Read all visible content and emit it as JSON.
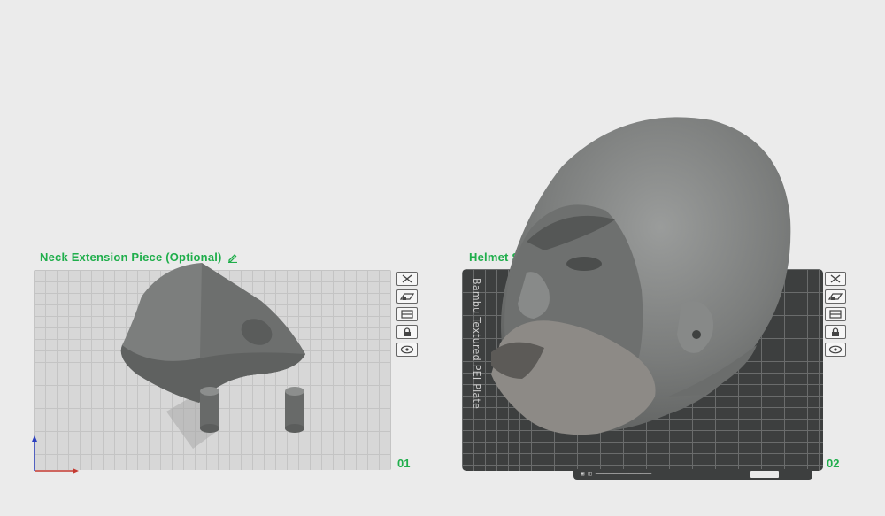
{
  "plates": [
    {
      "title": "Neck Extension Piece (Optional)",
      "number": "01",
      "toolbar": [
        "close-icon",
        "arrange-icon",
        "orient-icon",
        "lock-icon",
        "view-icon"
      ]
    },
    {
      "title": "Helmet S",
      "number": "02",
      "plate_label": "Bambu Textured PEI Plate",
      "toolbar": [
        "close-icon",
        "arrange-icon",
        "orient-icon",
        "lock-icon",
        "view-icon"
      ]
    }
  ],
  "colors": {
    "accent": "#1fae4b",
    "background": "#ebebeb",
    "light_plate": "#d7d7d7",
    "dark_plate": "#3d3f3f",
    "model_gray": "#7a7c7b"
  }
}
